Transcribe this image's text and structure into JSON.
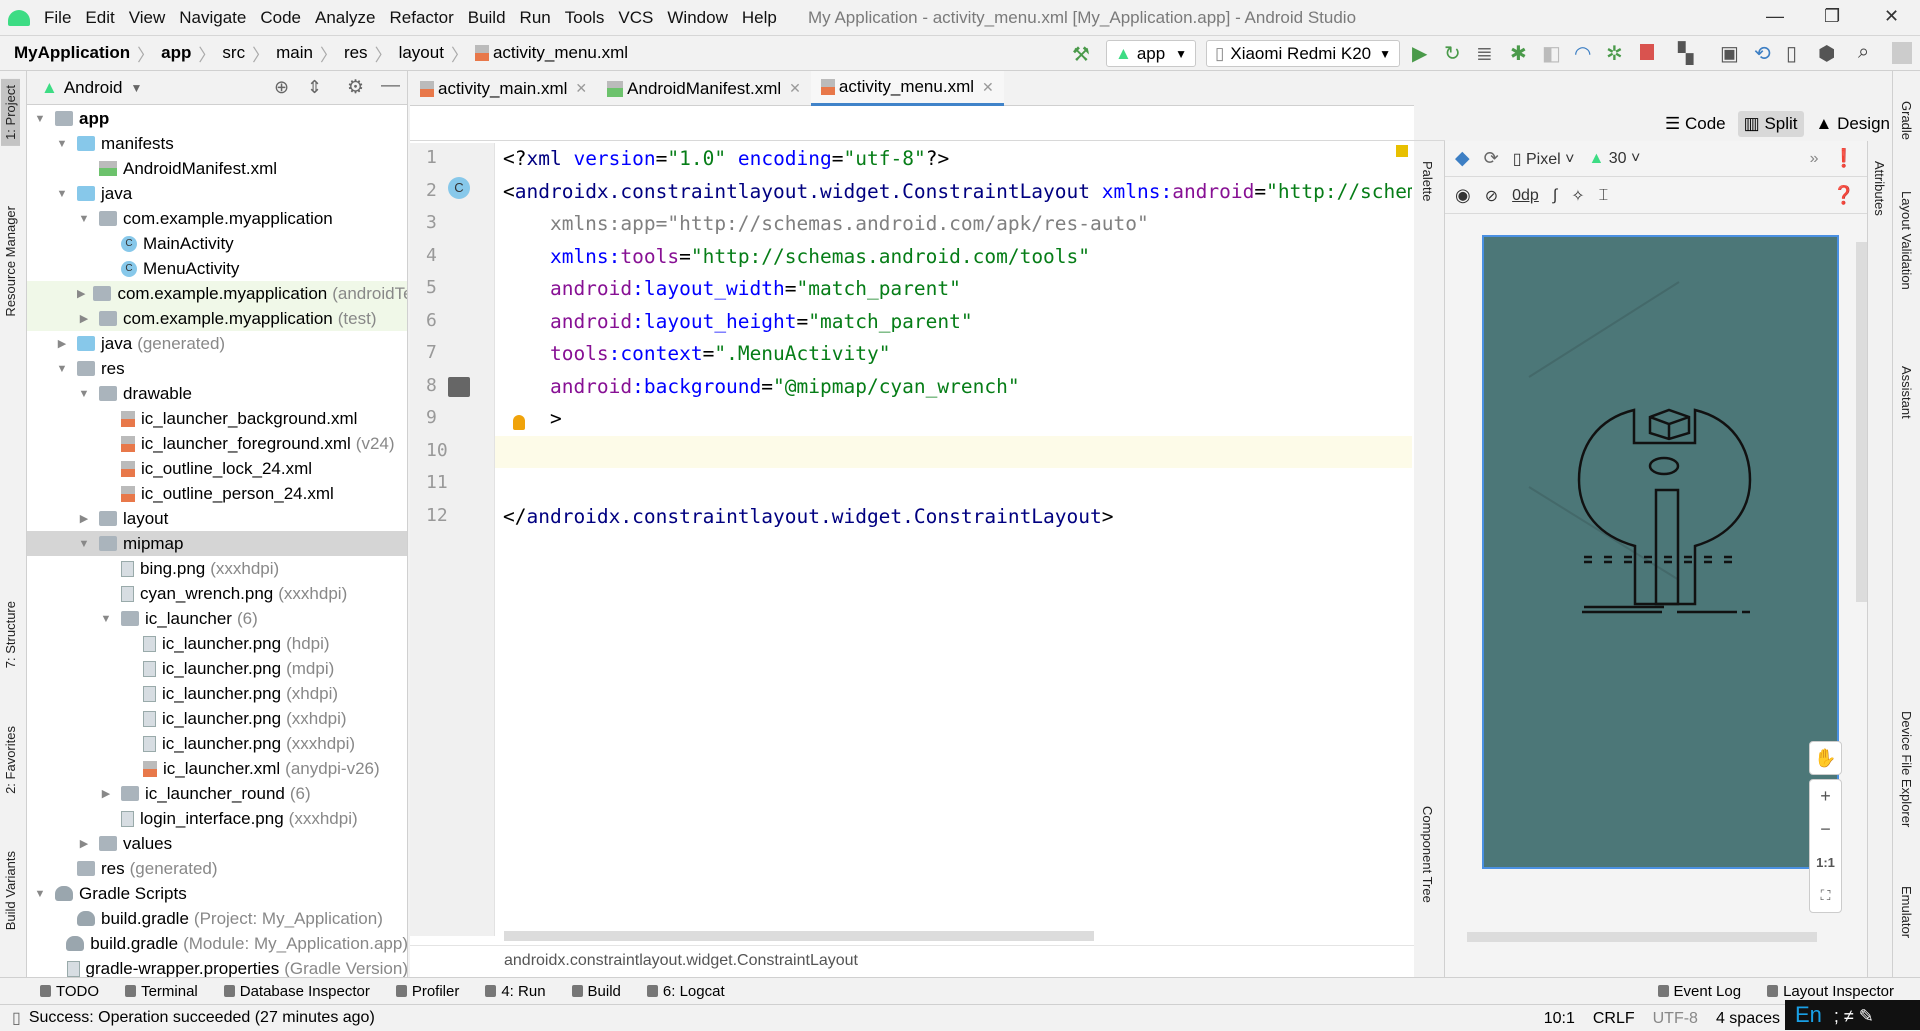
{
  "menu": [
    "File",
    "Edit",
    "View",
    "Navigate",
    "Code",
    "Analyze",
    "Refactor",
    "Build",
    "Run",
    "Tools",
    "VCS",
    "Window",
    "Help"
  ],
  "window_title": "My Application - activity_menu.xml [My_Application.app] - Android Studio",
  "breadcrumb": [
    "MyApplication",
    "app",
    "src",
    "main",
    "res",
    "layout",
    "activity_menu.xml"
  ],
  "toolbar": {
    "run_config": "app",
    "device": "Xiaomi Redmi K20"
  },
  "left_tabs": [
    "1: Project",
    "Resource Manager",
    "7: Structure",
    "2: Favorites",
    "Build Variants"
  ],
  "project": {
    "view": "Android",
    "tree": [
      {
        "level": 0,
        "arrow": "open",
        "icon": "folder",
        "label": "app",
        "bold": true
      },
      {
        "level": 1,
        "arrow": "open",
        "icon": "bfolder",
        "label": "manifests"
      },
      {
        "level": 2,
        "arrow": "",
        "icon": "mf",
        "label": "AndroidManifest.xml"
      },
      {
        "level": 1,
        "arrow": "open",
        "icon": "bfolder",
        "label": "java"
      },
      {
        "level": 2,
        "arrow": "open",
        "icon": "folder",
        "label": "com.example.myapplication"
      },
      {
        "level": 3,
        "arrow": "",
        "icon": "cls",
        "label": "MainActivity"
      },
      {
        "level": 3,
        "arrow": "",
        "icon": "cls",
        "label": "MenuActivity"
      },
      {
        "level": 2,
        "arrow": "closed",
        "icon": "folder",
        "label": "com.example.myapplication",
        "suffix": "(androidTest)",
        "hl": true
      },
      {
        "level": 2,
        "arrow": "closed",
        "icon": "folder",
        "label": "com.example.myapplication",
        "suffix": "(test)",
        "hl": true
      },
      {
        "level": 1,
        "arrow": "closed",
        "icon": "bfolder",
        "label": "java",
        "suffix": "(generated)"
      },
      {
        "level": 1,
        "arrow": "open",
        "icon": "folder",
        "label": "res"
      },
      {
        "level": 2,
        "arrow": "open",
        "icon": "folder",
        "label": "drawable"
      },
      {
        "level": 3,
        "arrow": "",
        "icon": "xml",
        "label": "ic_launcher_background.xml"
      },
      {
        "level": 3,
        "arrow": "",
        "icon": "xml",
        "label": "ic_launcher_foreground.xml",
        "suffix": "(v24)"
      },
      {
        "level": 3,
        "arrow": "",
        "icon": "xml",
        "label": "ic_outline_lock_24.xml"
      },
      {
        "level": 3,
        "arrow": "",
        "icon": "xml",
        "label": "ic_outline_person_24.xml"
      },
      {
        "level": 2,
        "arrow": "closed",
        "icon": "folder",
        "label": "layout"
      },
      {
        "level": 2,
        "arrow": "open",
        "icon": "folder",
        "label": "mipmap",
        "sel": true
      },
      {
        "level": 3,
        "arrow": "",
        "icon": "png",
        "label": "bing.png",
        "suffix": "(xxxhdpi)"
      },
      {
        "level": 3,
        "arrow": "",
        "icon": "png",
        "label": "cyan_wrench.png",
        "suffix": "(xxxhdpi)"
      },
      {
        "level": 3,
        "arrow": "open",
        "icon": "folder",
        "label": "ic_launcher",
        "suffix": "(6)"
      },
      {
        "level": 4,
        "arrow": "",
        "icon": "png",
        "label": "ic_launcher.png",
        "suffix": "(hdpi)"
      },
      {
        "level": 4,
        "arrow": "",
        "icon": "png",
        "label": "ic_launcher.png",
        "suffix": "(mdpi)"
      },
      {
        "level": 4,
        "arrow": "",
        "icon": "png",
        "label": "ic_launcher.png",
        "suffix": "(xhdpi)"
      },
      {
        "level": 4,
        "arrow": "",
        "icon": "png",
        "label": "ic_launcher.png",
        "suffix": "(xxhdpi)"
      },
      {
        "level": 4,
        "arrow": "",
        "icon": "png",
        "label": "ic_launcher.png",
        "suffix": "(xxxhdpi)"
      },
      {
        "level": 4,
        "arrow": "",
        "icon": "xml",
        "label": "ic_launcher.xml",
        "suffix": "(anydpi-v26)"
      },
      {
        "level": 3,
        "arrow": "closed",
        "icon": "folder",
        "label": "ic_launcher_round",
        "suffix": "(6)"
      },
      {
        "level": 3,
        "arrow": "",
        "icon": "png",
        "label": "login_interface.png",
        "suffix": "(xxxhdpi)"
      },
      {
        "level": 2,
        "arrow": "closed",
        "icon": "folder",
        "label": "values"
      },
      {
        "level": 1,
        "arrow": "",
        "icon": "folder",
        "label": "res",
        "suffix": "(generated)"
      },
      {
        "level": 0,
        "arrow": "open",
        "icon": "gradle",
        "label": "Gradle Scripts"
      },
      {
        "level": 1,
        "arrow": "",
        "icon": "gradle",
        "label": "build.gradle",
        "suffix": "(Project: My_Application)"
      },
      {
        "level": 1,
        "arrow": "",
        "icon": "gradle",
        "label": "build.gradle",
        "suffix": "(Module: My_Application.app)"
      },
      {
        "level": 1,
        "arrow": "",
        "icon": "png",
        "label": "gradle-wrapper.properties",
        "suffix": "(Gradle Version)"
      }
    ]
  },
  "tabs": [
    {
      "label": "activity_main.xml",
      "icon": "xml"
    },
    {
      "label": "AndroidManifest.xml",
      "icon": "mf"
    },
    {
      "label": "activity_menu.xml",
      "icon": "xml",
      "active": true
    }
  ],
  "modes": [
    "Code",
    "Split",
    "Design"
  ],
  "active_mode": "Split",
  "code": [
    [
      [
        "p",
        "<?"
      ],
      [
        "t",
        "xml "
      ],
      [
        "a",
        "version"
      ],
      [
        "p",
        "="
      ],
      [
        "v",
        "\"1.0\" "
      ],
      [
        "a",
        "encoding"
      ],
      [
        "p",
        "="
      ],
      [
        "v",
        "\"utf-8\""
      ],
      [
        "p",
        "?>"
      ]
    ],
    [
      [
        "p",
        "<"
      ],
      [
        "t",
        "androidx.constraintlayout.widget.ConstraintLayout "
      ],
      [
        "a",
        "xmlns:"
      ],
      [
        "n",
        "android"
      ],
      [
        "p",
        "="
      ],
      [
        "v",
        "\"http://schemas.android.com/apk/res/android\""
      ]
    ],
    [
      [
        "g",
        "    xmlns:app=\"http://schemas.android.com/apk/res-auto\""
      ]
    ],
    [
      [
        "a",
        "    xmlns:"
      ],
      [
        "n",
        "tools"
      ],
      [
        "p",
        "="
      ],
      [
        "v",
        "\"http://schemas.android.com/tools\""
      ]
    ],
    [
      [
        "n",
        "    android"
      ],
      [
        "a",
        ":layout_width"
      ],
      [
        "p",
        "="
      ],
      [
        "v",
        "\"match_parent\""
      ]
    ],
    [
      [
        "n",
        "    android"
      ],
      [
        "a",
        ":layout_height"
      ],
      [
        "p",
        "="
      ],
      [
        "v",
        "\"match_parent\""
      ]
    ],
    [
      [
        "n",
        "    tools"
      ],
      [
        "a",
        ":context"
      ],
      [
        "p",
        "="
      ],
      [
        "v",
        "\".MenuActivity\""
      ]
    ],
    [
      [
        "n",
        "    android"
      ],
      [
        "a",
        ":background"
      ],
      [
        "p",
        "="
      ],
      [
        "v",
        "\"@mipmap/cyan_wrench\""
      ]
    ],
    [
      [
        "p",
        "    >"
      ]
    ],
    [],
    [],
    [
      [
        "p",
        "</"
      ],
      [
        "t",
        "androidx.constraintlayout.widget.ConstraintLayout"
      ],
      [
        "p",
        ">"
      ]
    ]
  ],
  "current_line": 10,
  "editor_breadcrumb": "androidx.constraintlayout.widget.ConstraintLayout",
  "palette_tabs": [
    "Palette",
    "Component Tree"
  ],
  "design_toolbar": {
    "device": "Pixel",
    "api": "30",
    "margin": "0dp"
  },
  "preview_background": "#4c7778",
  "zoom_controls": [
    "+",
    "−",
    "1:1"
  ],
  "right_tabs": [
    "Gradle",
    "Layout Validation",
    "Assistant",
    "Device File Explorer",
    "Emulator"
  ],
  "attributes_tab": "Attributes",
  "bottom_tools": [
    "TODO",
    "Terminal",
    "Database Inspector",
    "Profiler",
    "4: Run",
    "Build",
    "6: Logcat"
  ],
  "bottom_tools_right": [
    "Event Log",
    "Layout Inspector"
  ],
  "status": {
    "message": "Success: Operation succeeded (27 minutes ago)",
    "position": "10:1",
    "line_sep": "CRLF",
    "encoding": "UTF-8",
    "indent": "4 spaces"
  },
  "ime": "En"
}
